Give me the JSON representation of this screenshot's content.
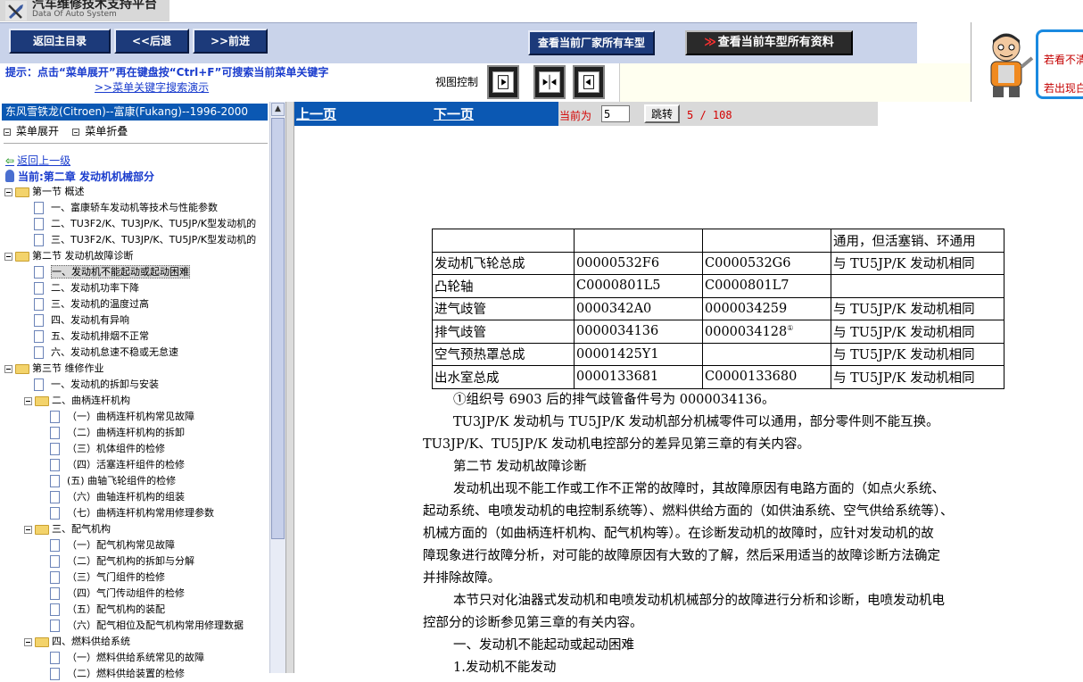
{
  "app": {
    "title": "汽车维修技术支持平台",
    "subtitle": "Data Of Auto System"
  },
  "toolbar": {
    "home": "返回主目录",
    "back": "<<后退",
    "forward": ">>前进",
    "all_models": "查看当前厂家所有车型",
    "all_docs_arrow": "≫",
    "all_docs": "查看当前车型所有资料"
  },
  "tip": {
    "text": "提示：点击“菜单展开”再在键盘按“Ctrl+F”可搜索当前菜单关键字",
    "link": ">>菜单关键字搜索演示",
    "view_label": "视图控制"
  },
  "mascot": {
    "line1": "若看不清",
    "line2": "若出现白"
  },
  "sidebar": {
    "model": "东风雪铁龙(Citroen)--富康(Fukang)--1996-2000",
    "expand": "菜单展开",
    "collapse": "菜单折叠",
    "back_up": "返回上一级",
    "current": "当前:第二章 发动机机械部分",
    "tree": [
      {
        "label": "第一节 概述",
        "type": "section",
        "level": 0
      },
      {
        "label": "一、富康轿车发动机等技术与性能参数",
        "type": "doc",
        "level": 1
      },
      {
        "label": "二、TU3F2/K、TU3JP/K、TU5JP/K型发动机的",
        "type": "doc",
        "level": 1
      },
      {
        "label": "三、TU3F2/K、TU3JP/K、TU5JP/K型发动机的",
        "type": "doc",
        "level": 1
      },
      {
        "label": "第二节 发动机故障诊断",
        "type": "section",
        "level": 0
      },
      {
        "label": "一、发动机不能起动或起动困难",
        "type": "doc",
        "level": 1,
        "selected": true
      },
      {
        "label": "二、发动机功率下降",
        "type": "doc",
        "level": 1
      },
      {
        "label": "三、发动机的温度过高",
        "type": "doc",
        "level": 1
      },
      {
        "label": "四、发动机有异响",
        "type": "doc",
        "level": 1
      },
      {
        "label": "五、发动机排烟不正常",
        "type": "doc",
        "level": 1
      },
      {
        "label": "六、发动机怠速不稳或无怠速",
        "type": "doc",
        "level": 1
      },
      {
        "label": "第三节 维修作业",
        "type": "section",
        "level": 0
      },
      {
        "label": "一、发动机的拆卸与安装",
        "type": "doc",
        "level": 1
      },
      {
        "label": "二、曲柄连杆机构",
        "type": "section",
        "level": 1
      },
      {
        "label": "（一）曲柄连杆机构常见故障",
        "type": "doc",
        "level": 2
      },
      {
        "label": "（二）曲柄连杆机构的拆卸",
        "type": "doc",
        "level": 2
      },
      {
        "label": "（三）机体组件的检修",
        "type": "doc",
        "level": 2
      },
      {
        "label": "（四）活塞连杆组件的检修",
        "type": "doc",
        "level": 2
      },
      {
        "label": "(五) 曲轴飞轮组件的检修",
        "type": "doc",
        "level": 2
      },
      {
        "label": "（六）曲轴连杆机构的组装",
        "type": "doc",
        "level": 2
      },
      {
        "label": "（七）曲柄连杆机构常用修理参数",
        "type": "doc",
        "level": 2
      },
      {
        "label": "三、配气机构",
        "type": "section",
        "level": 1
      },
      {
        "label": "（一）配气机构常见故障",
        "type": "doc",
        "level": 2
      },
      {
        "label": "（二）配气机构的拆卸与分解",
        "type": "doc",
        "level": 2
      },
      {
        "label": "（三）气门组件的检修",
        "type": "doc",
        "level": 2
      },
      {
        "label": "（四）气门传动组件的检修",
        "type": "doc",
        "level": 2
      },
      {
        "label": "（五）配气机构的装配",
        "type": "doc",
        "level": 2
      },
      {
        "label": "（六）配气相位及配气机构常用修理数据",
        "type": "doc",
        "level": 2
      },
      {
        "label": "四、燃料供给系统",
        "type": "section",
        "level": 1
      },
      {
        "label": "（一）燃料供给系统常见的故障",
        "type": "doc",
        "level": 2
      },
      {
        "label": "（二）燃料供给装置的检修",
        "type": "doc",
        "level": 2
      }
    ]
  },
  "pager": {
    "prev": "上一页",
    "next": "下一页",
    "current_label": "当前为",
    "page_value": "5",
    "jump": "跳转",
    "count": "5 / 108"
  },
  "document": {
    "table": [
      [
        "",
        "",
        "",
        "通用，但活塞销、环通用"
      ],
      [
        "发动机飞轮总成",
        "00000532F6",
        "C0000532G6",
        "与 TU5JP/K 发动机相同"
      ],
      [
        "凸轮轴",
        "C0000801L5",
        "C0000801L7",
        ""
      ],
      [
        "进气歧管",
        "0000342A0",
        "0000034259",
        "与 TU5JP/K 发动机相同"
      ],
      [
        "排气歧管",
        "0000034136",
        "0000034128",
        "与 TU5JP/K 发动机相同"
      ],
      [
        "空气预热罩总成",
        "00001425Y1",
        "",
        "与 TU5JP/K 发动机相同"
      ],
      [
        "出水室总成",
        "0000133681",
        "C0000133680",
        "与 TU5JP/K 发动机相同"
      ]
    ],
    "footnote_mark": "①",
    "paragraphs": [
      "①组织号 6903 后的排气歧管备件号为 0000034136。",
      "TU3JP/K  发动机与  TU5JP/K  发动机部分机械零件可以通用，部分零件则不能互换。",
      "TU3JP/K、TU5JP/K 发动机电控部分的差异见第三章的有关内容。",
      "第二节    发动机故障诊断",
      "发动机出现不能工作或工作不正常的故障时，其故障原因有电路方面的（如点火系统、",
      "起动系统、电喷发动机的电控制系统等）、燃料供给方面的（如供油系统、空气供给系统等）、",
      "机械方面的（如曲柄连杆机构、配气机构等）。在诊断发动机的故障时，应针对发动机的故",
      "障现象进行故障分析，对可能的故障原因有大致的了解，然后采用适当的故障诊断方法确定",
      "并排除故障。",
      "本节只对化油器式发动机和电喷发动机机械部分的故障进行分析和诊断，电喷发动机电",
      "控部分的诊断参见第三章的有关内容。",
      "一、发动机不能起动或起动困难",
      "1.发动机不能发动"
    ]
  }
}
